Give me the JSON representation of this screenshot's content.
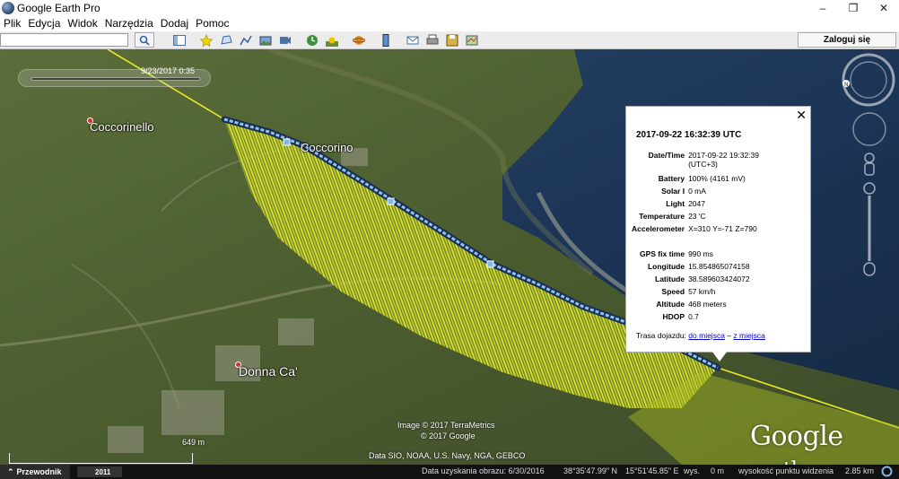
{
  "window": {
    "title": "Google Earth Pro",
    "minimize": "–",
    "maximize": "❐",
    "close": "✕"
  },
  "menu": [
    "Plik",
    "Edycja",
    "Widok",
    "Narzędzia",
    "Dodaj",
    "Pomoc"
  ],
  "toolbar": {
    "search_value": "",
    "login_label": "Zaloguj się",
    "icons": [
      "sidebar-icon",
      "placemark-icon",
      "polygon-icon",
      "path-icon",
      "image-overlay-icon",
      "record-tour-icon",
      "historical-imagery-icon",
      "sunlight-icon",
      "planets-icon",
      "ruler-icon",
      "email-icon",
      "print-icon",
      "save-image-icon",
      "maps-icon"
    ]
  },
  "map": {
    "time_label": "9/23/2017  0:35",
    "places": [
      {
        "name": "Coccorinello"
      },
      {
        "name": "Coccorino"
      },
      {
        "name": "Donna Ca'"
      }
    ],
    "credits": {
      "image": "Image © 2017 TerraMetrics",
      "google": "© 2017 Google",
      "data": "Data SIO, NOAA, U.S. Navy, NGA, GEBCO"
    },
    "logo_main": "Google",
    "logo_sub": "earth",
    "scale_label": "649 m"
  },
  "balloon": {
    "title": "2017-09-22 16:32:39 UTC",
    "close": "✕",
    "rows": [
      {
        "k": "Date/Time",
        "v": "2017-09-22 19:32:39 (UTC+3)"
      },
      {
        "k": "Battery",
        "v": "100% (4161 mV)"
      },
      {
        "k": "Solar I",
        "v": "0 mA"
      },
      {
        "k": "Light",
        "v": "2047"
      },
      {
        "k": "Temperature",
        "v": "23 'C"
      },
      {
        "k": "Accelerometer",
        "v": "X=310 Y=-71 Z=790"
      },
      {
        "k": "",
        "v": ""
      },
      {
        "k": "GPS fix time",
        "v": "990 ms"
      },
      {
        "k": "Longitude",
        "v": "15.854865074158"
      },
      {
        "k": "Latitude",
        "v": "38.589603424072"
      },
      {
        "k": "Speed",
        "v": "57 km/h"
      },
      {
        "k": "Altitude",
        "v": "468 meters"
      },
      {
        "k": "HDOP",
        "v": "0.7"
      }
    ],
    "route_prefix": "Trasa dojazdu:",
    "route_to": "do miejsca",
    "route_sep": " – ",
    "route_from": "z miejsca"
  },
  "status": {
    "tab": "Przewodnik",
    "history": "2011",
    "date": "Data uzyskania obrazu: 6/30/2016",
    "lat": "38°35'47.99\" N",
    "lon": "15°51'45.85\" E",
    "elev_label": "wys.",
    "elev": "0 m",
    "view_label": "wysokość punktu widzenia",
    "view": "2.85 km"
  },
  "colors": {
    "track": "#f0f000",
    "curtain": "#c8d430",
    "sea": "#1d3552"
  }
}
